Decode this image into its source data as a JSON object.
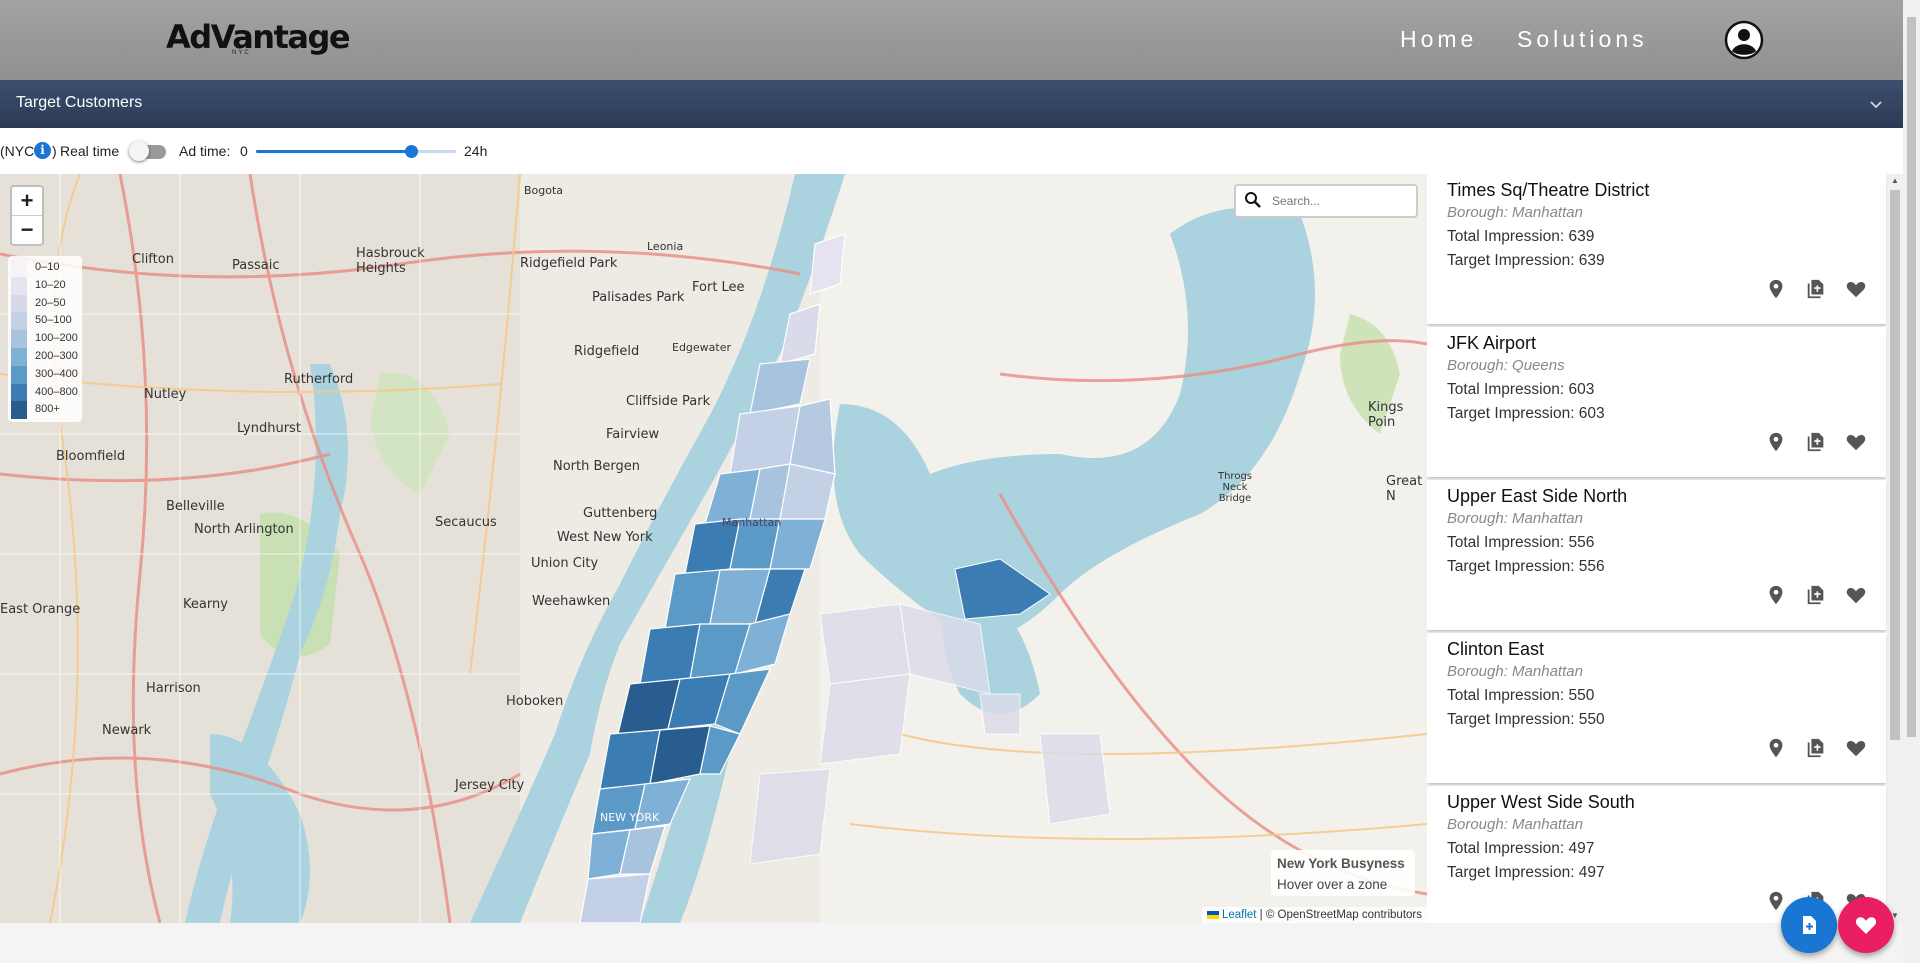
{
  "header": {
    "logo": "AdVantage",
    "logo_sub": "NYC",
    "nav": [
      {
        "label": "Home"
      },
      {
        "label": "Solutions"
      }
    ]
  },
  "accordion": {
    "title": "Target Customers"
  },
  "controls": {
    "timezone_label": "(NYC",
    "timezone_close": ")",
    "realtime_label": "Real time",
    "realtime_on": false,
    "adtime_label": "Ad time:",
    "adtime_min": "0",
    "adtime_max": "24h",
    "adtime_value_fraction": 0.78
  },
  "map": {
    "zoom_in": "+",
    "zoom_out": "−",
    "legend": [
      {
        "label": "0–10",
        "color": "#f4f3f8"
      },
      {
        "label": "10–20",
        "color": "#e5e4f0"
      },
      {
        "label": "20–50",
        "color": "#d5d9ea"
      },
      {
        "label": "50–100",
        "color": "#c3d0e5"
      },
      {
        "label": "100–200",
        "color": "#a8c3dd"
      },
      {
        "label": "200–300",
        "color": "#7fb0d5"
      },
      {
        "label": "300–400",
        "color": "#5b9ac6"
      },
      {
        "label": "400–800",
        "color": "#3b7db3"
      },
      {
        "label": "800+",
        "color": "#2a5d8f"
      }
    ],
    "search_placeholder": "Search...",
    "info_title": "New York Busyness",
    "info_hint": "Hover over a zone",
    "attribution_link": "Leaflet",
    "attribution_text": "| © OpenStreetMap contributors",
    "place_labels": {
      "manhattan": "Manhattan",
      "new_york": "NEW YORK",
      "hoboken": "Hoboken",
      "jersey_city": "Jersey City",
      "newark": "Newark",
      "secaucus": "Secaucus",
      "union_city": "Union City",
      "weehawken": "Weehawken",
      "west_new_york": "West New York",
      "guttenberg": "Guttenberg",
      "north_bergen": "North Bergen",
      "fairview": "Fairview",
      "cliffside_park": "Cliffside Park",
      "fort_lee": "Fort Lee",
      "palisades_park": "Palisades Park",
      "ridgefield_park": "Ridgefield Park",
      "ridgefield": "Ridgefield",
      "hasbrouck_heights": "Hasbrouck Heights",
      "passaic": "Passaic",
      "clifton": "Clifton",
      "rutherford": "Rutherford",
      "nutley": "Nutley",
      "lyndhurst": "Lyndhurst",
      "bloomfield": "Bloomfield",
      "belleville": "Belleville",
      "north_arlington": "North Arlington",
      "kearny": "Kearny",
      "harrison": "Harrison",
      "east_orange": "East Orange",
      "edgewater": "Edgewater",
      "bogota": "Bogota",
      "leonia": "Leonia",
      "throgs": "Throgs Neck Bridge",
      "kings_point": "Kings Poin",
      "great_neck": "Great N"
    }
  },
  "results": [
    {
      "name": "Times Sq/Theatre District",
      "borough": "Borough: Manhattan",
      "total": "Total Impression: 639",
      "target": "Target Impression: 639"
    },
    {
      "name": "JFK Airport",
      "borough": "Borough: Queens",
      "total": "Total Impression: 603",
      "target": "Target Impression: 603"
    },
    {
      "name": "Upper East Side North",
      "borough": "Borough: Manhattan",
      "total": "Total Impression: 556",
      "target": "Target Impression: 556"
    },
    {
      "name": "Clinton East",
      "borough": "Borough: Manhattan",
      "total": "Total Impression: 550",
      "target": "Target Impression: 550"
    },
    {
      "name": "Upper West Side South",
      "borough": "Borough: Manhattan",
      "total": "Total Impression: 497",
      "target": "Target Impression: 497"
    }
  ],
  "colors": {
    "header_bg": "#999999",
    "accordion_bg": "#34445f",
    "accent_blue": "#1976d2",
    "fab_pink": "#e91e63",
    "water": "#aad3df"
  }
}
